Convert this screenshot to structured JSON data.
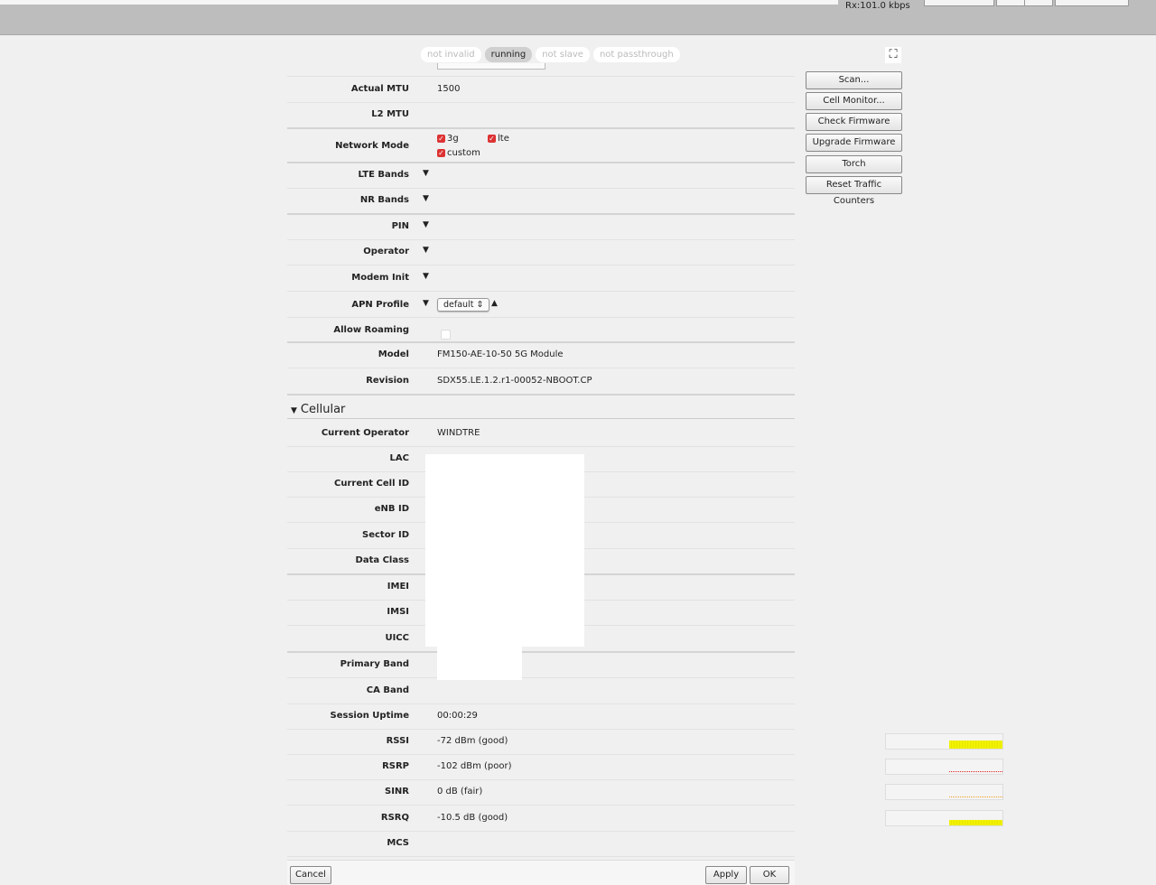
{
  "topbar": {
    "rx": "Rx:101.0 kbps"
  },
  "flags": [
    {
      "label": "not invalid",
      "on": false
    },
    {
      "label": "running",
      "on": true
    },
    {
      "label": "not slave",
      "on": false
    },
    {
      "label": "not passthrough",
      "on": false
    }
  ],
  "side_buttons": [
    "Scan...",
    "Cell Monitor...",
    "Check Firmware",
    "Upgrade Firmware",
    "Torch",
    "Reset Traffic Counters"
  ],
  "network_mode": {
    "label": "Network Mode",
    "options": [
      {
        "label": "3g",
        "checked": true
      },
      {
        "label": "lte",
        "checked": true
      },
      {
        "label": "custom",
        "checked": true
      }
    ]
  },
  "apn_profile": {
    "label": "APN Profile",
    "value": "default"
  },
  "allow_roaming": {
    "label": "Allow Roaming",
    "checked": false
  },
  "rows": [
    {
      "label": "Actual MTU",
      "value": "1500"
    },
    {
      "label": "L2 MTU",
      "value": ""
    },
    {
      "label": "LTE Bands",
      "value": "",
      "dropdown": true
    },
    {
      "label": "NR Bands",
      "value": "",
      "dropdown": true
    },
    {
      "label": "PIN",
      "value": "",
      "dropdown": true
    },
    {
      "label": "Operator",
      "value": "",
      "dropdown": true
    },
    {
      "label": "Modem Init",
      "value": "",
      "dropdown": true
    },
    {
      "label": "Model",
      "value": "FM150-AE-10-50 5G Module"
    },
    {
      "label": "Revision",
      "value": "SDX55.LE.1.2.r1-00052-NBOOT.CP"
    }
  ],
  "cellular": {
    "title": "Cellular",
    "rows": [
      {
        "label": "Current Operator",
        "value": "WINDTRE"
      },
      {
        "label": "LAC",
        "value": ""
      },
      {
        "label": "Current Cell ID",
        "value": ""
      },
      {
        "label": "eNB ID",
        "value": ""
      },
      {
        "label": "Sector ID",
        "value": ""
      },
      {
        "label": "Data Class",
        "value": ""
      },
      {
        "label": "IMEI",
        "value": ""
      },
      {
        "label": "IMSI",
        "value": ""
      },
      {
        "label": "UICC",
        "value": ""
      },
      {
        "label": "Primary Band",
        "value": ""
      },
      {
        "label": "CA Band",
        "value": ""
      },
      {
        "label": "Session Uptime",
        "value": "00:00:29"
      },
      {
        "label": "RSSI",
        "value": "-72 dBm (good)",
        "meter": "good",
        "color": "#f2f200"
      },
      {
        "label": "RSRP",
        "value": "-102 dBm (poor)",
        "meter": "poor",
        "color": "#e02020"
      },
      {
        "label": "SINR",
        "value": "0 dB (fair)",
        "meter": "fair",
        "color": "#f0a020"
      },
      {
        "label": "RSRQ",
        "value": "-10.5 dB (good)",
        "meter": "good",
        "color": "#f2f200"
      },
      {
        "label": "MCS",
        "value": ""
      }
    ]
  },
  "footer": {
    "cancel": "Cancel",
    "apply": "Apply",
    "ok": "OK"
  }
}
